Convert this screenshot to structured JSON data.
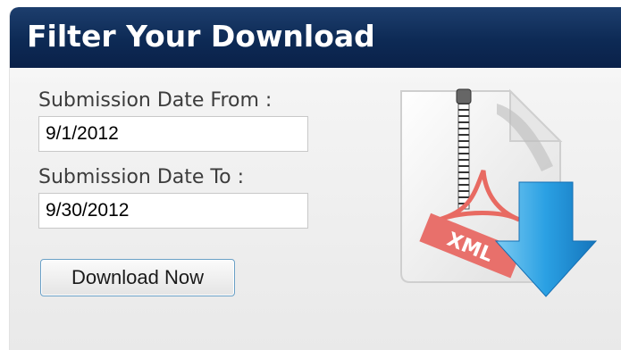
{
  "header": {
    "title": "Filter Your Download"
  },
  "form": {
    "from_label": "Submission Date From :",
    "from_value": "9/1/2012",
    "to_label": "Submission Date To :",
    "to_value": "9/30/2012",
    "download_button": "Download Now"
  },
  "graphic": {
    "icon": "zip-xml-download-icon",
    "badge_text": "XML",
    "colors": {
      "badge": "#e8706b",
      "arrow": "#1e8fd6",
      "header": "#0f2d5a"
    }
  }
}
